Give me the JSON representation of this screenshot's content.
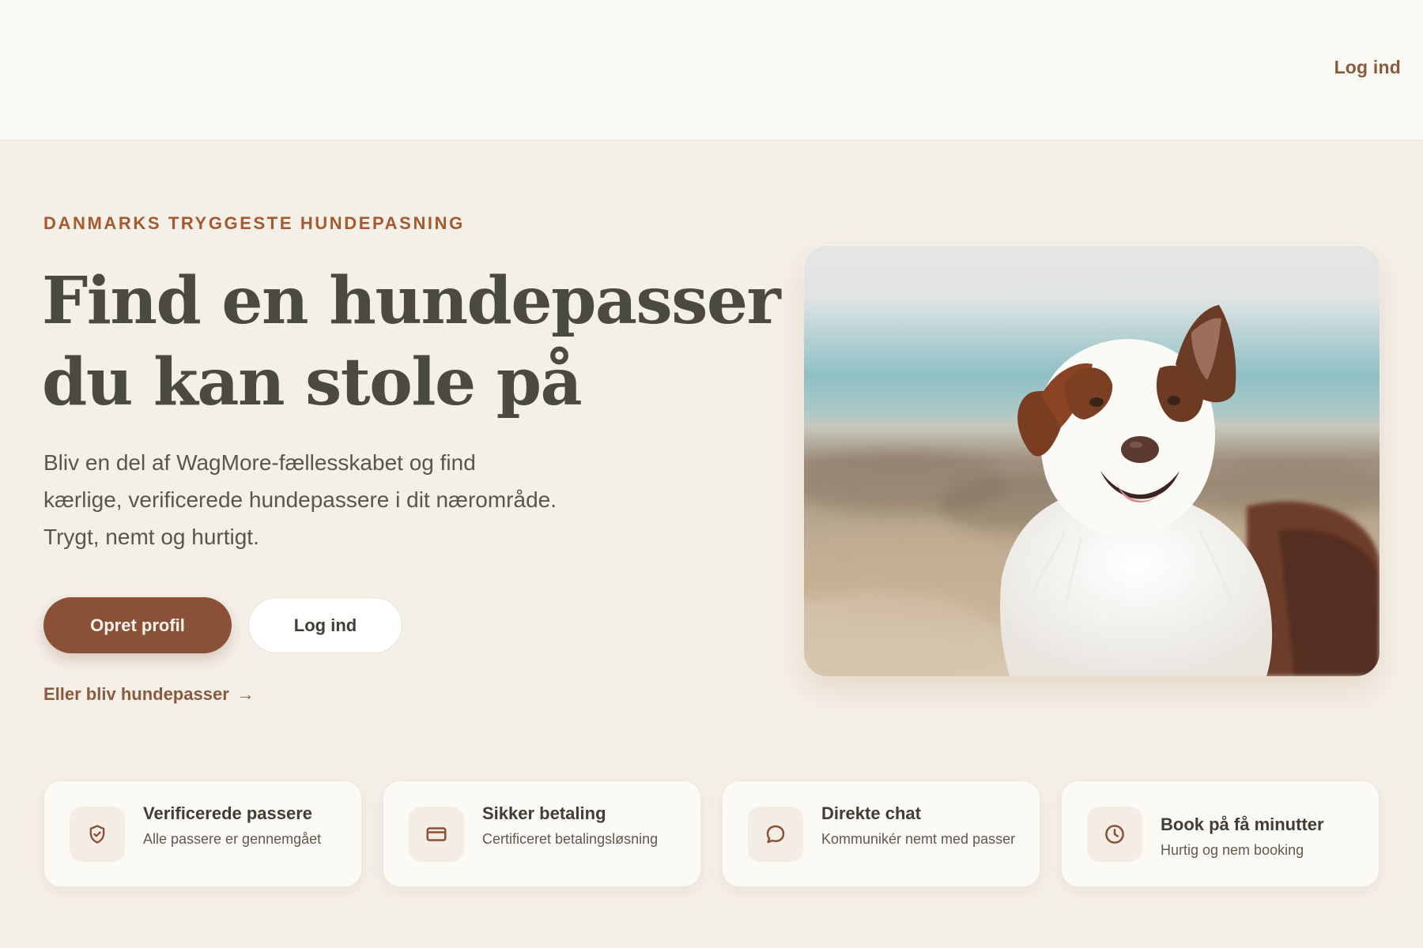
{
  "header": {
    "login_label": "Log ind"
  },
  "hero": {
    "eyebrow": "DANMARKS TRYGGESTE HUNDEPASNING",
    "title_lines": [
      "Find en hundepasser",
      "du kan stole på"
    ],
    "subtitle_lines": [
      "Bliv en del af WagMore-fællesskabet og find",
      "kærlige, verificerede hundepassere i dit nærområde.",
      "Trygt, nemt og hurtigt."
    ],
    "primary_button": "Opret profil",
    "secondary_button": "Log ind",
    "sitter_link": "Eller bliv hundepasser",
    "sitter_link_arrow": "→"
  },
  "features": [
    {
      "title": "Verificerede passere",
      "desc": "Alle passere er gennemgået",
      "icon": "shield-check-icon"
    },
    {
      "title": "Sikker betaling",
      "desc": "Certificeret betalingsløsning",
      "icon": "credit-card-icon"
    },
    {
      "title": "Direkte chat",
      "desc": "Kommunikér nemt med passer",
      "icon": "chat-bubble-icon"
    },
    {
      "title": "Book på få minutter",
      "desc": "Hurtig og nem booking",
      "icon": "clock-icon"
    }
  ],
  "colors": {
    "accent": "#8b5038",
    "eyebrow": "#a4592e",
    "background": "#f4f0e8",
    "header_bg": "#fbf9f4"
  }
}
